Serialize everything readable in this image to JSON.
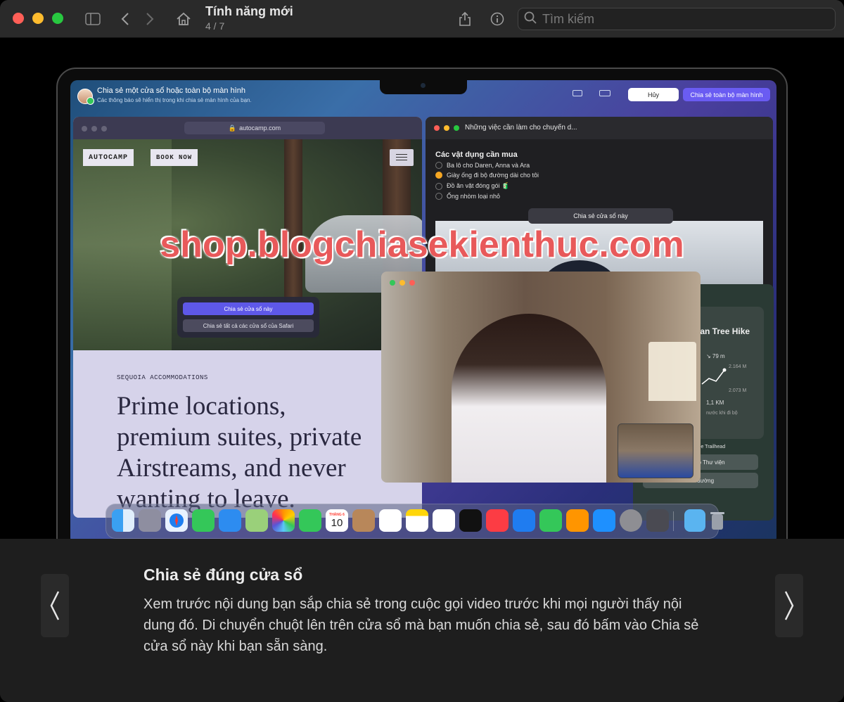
{
  "window": {
    "title": "Tính năng mới",
    "page_indicator": "4 / 7"
  },
  "toolbar": {
    "search_placeholder": "Tìm kiếm",
    "icons": [
      "sidebar-icon",
      "back-icon",
      "forward-icon",
      "home-icon",
      "share-icon",
      "info-icon",
      "search-icon"
    ]
  },
  "screen": {
    "share_bar": {
      "title": "Chia sẻ một cửa sổ hoặc toàn bộ màn hình",
      "subtitle": "Các thông báo sẽ hiển thị trong khi chia sẻ màn hình của bạn.",
      "cancel_label": "Hủy",
      "share_all_label": "Chia sẻ toàn bộ màn hình"
    },
    "safari": {
      "url": "autocamp.com",
      "logo": "AUTOCAMP",
      "book_now": "BOOK NOW",
      "popup_share_window": "Chia sẻ cửa sổ này",
      "popup_share_all": "Chia sẻ tất cả các cửa sổ của Safari",
      "section_label": "SEQUOIA ACCOMMODATIONS",
      "headline": "Prime locations, premium suites, private Airstreams, and never wanting to leave."
    },
    "reminders": {
      "title": "Những việc cần làm cho chuyến d...",
      "heading": "Các vật dụng cần mua",
      "items": [
        {
          "text": "Ba lô cho Daren, Anna và Ara",
          "checked": false
        },
        {
          "text": "Giày ống đi bộ đường dài cho tôi",
          "checked": true
        },
        {
          "text": "Đồ ăn vặt đóng gói 🧃",
          "checked": false
        },
        {
          "text": "Ống nhòm loại nhỏ",
          "checked": false
        }
      ],
      "share_label": "Chia sẻ cửa sổ này"
    },
    "maps": {
      "title": "rman Tree Hike",
      "stat1": "↘ 79 m",
      "elev1": "2.164 M",
      "elev2": "2.073 M",
      "distance": "1,1 KM",
      "note": "nước khi đi bộ",
      "add_library": "Thêm vào Thư viện",
      "directions": "Chỉ đường",
      "trailhead": "Sherman Tree Trailhead"
    },
    "dock": {
      "calendar_month": "THÁNG 6",
      "calendar_day": "10",
      "apps": [
        "finder-icon",
        "launchpad-icon",
        "safari-icon",
        "messages-icon",
        "mail-icon",
        "maps-icon",
        "photos-icon",
        "facetime-icon",
        "calendar-icon",
        "contacts-icon",
        "reminders-icon",
        "notes-icon",
        "freeform-icon",
        "appletv-icon",
        "music-icon",
        "keynote-icon",
        "numbers-icon",
        "pages-icon",
        "appstore-icon",
        "settings-icon",
        "iphone-mirroring-icon",
        "downloads-folder-icon",
        "trash-icon"
      ]
    }
  },
  "watermark": "shop.blogchiasekienthuc.com",
  "info": {
    "title": "Chia sẻ đúng cửa sổ",
    "body": "Xem trước nội dung bạn sắp chia sẻ trong cuộc gọi video trước khi mọi người thấy nội dung đó. Di chuyển chuột lên trên cửa sổ mà bạn muốn chia sẻ, sau đó bấm vào Chia sẻ cửa sổ này khi bạn sẵn sàng."
  },
  "colors": {
    "accent_purple": "#6a5cf2",
    "close": "#ff5f57",
    "minimize": "#febc2e",
    "zoom": "#28c840",
    "watermark": "#e8595a"
  }
}
